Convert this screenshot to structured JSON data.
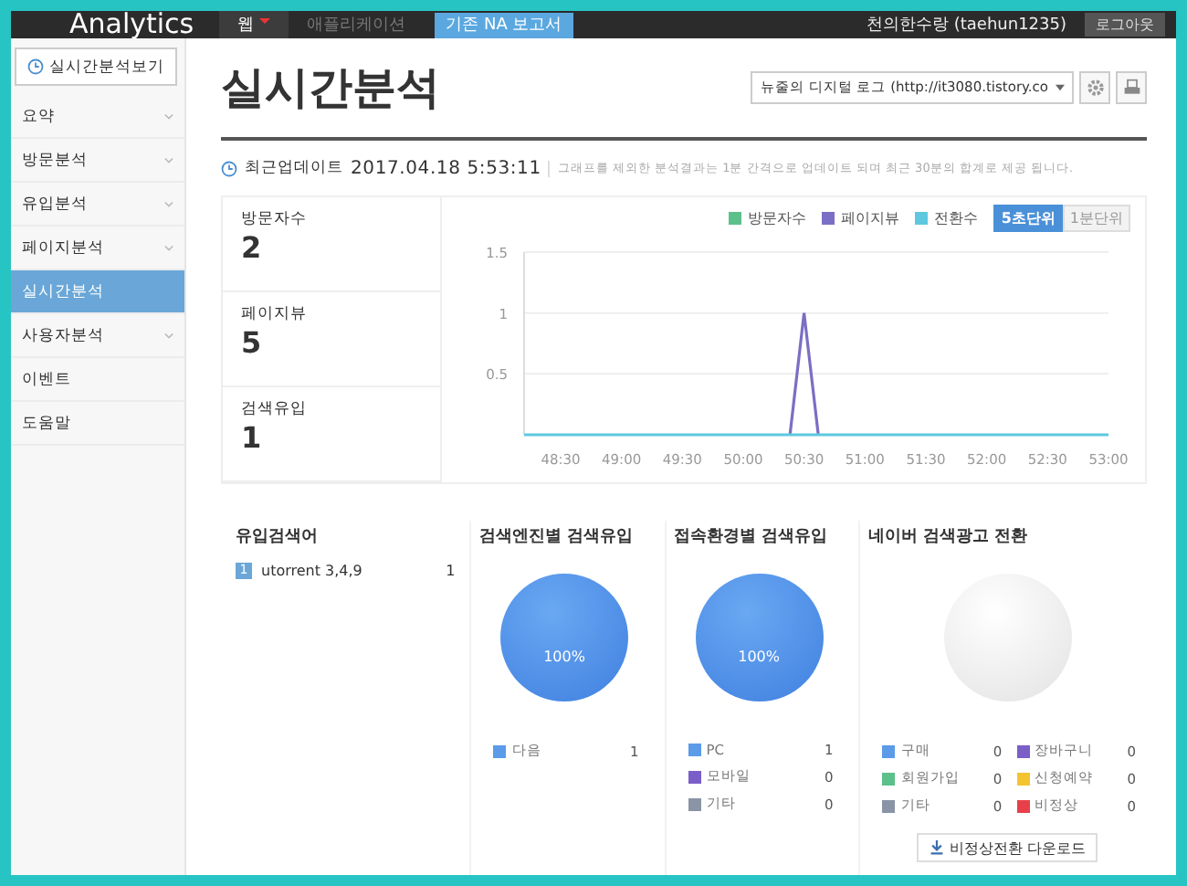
{
  "topbar": {
    "brand": "Analytics",
    "tabs": [
      {
        "label": "웹",
        "selected": true,
        "kind": "menu"
      },
      {
        "label": "애플리케이션",
        "selected": false,
        "kind": "menu"
      },
      {
        "label": "기존 NA 보고서",
        "selected": false,
        "kind": "badge"
      }
    ],
    "user": "천의한수랑 (taehun1235)",
    "logout": "로그아웃"
  },
  "sidebar": {
    "realtime_button": "실시간분석보기",
    "items": [
      {
        "label": "요약",
        "expandable": true,
        "selected": false
      },
      {
        "label": "방문분석",
        "expandable": true,
        "selected": false
      },
      {
        "label": "유입분석",
        "expandable": true,
        "selected": false
      },
      {
        "label": "페이지분석",
        "expandable": true,
        "selected": false
      },
      {
        "label": "실시간분석",
        "expandable": false,
        "selected": true
      },
      {
        "label": "사용자분석",
        "expandable": true,
        "selected": false
      },
      {
        "label": "이벤트",
        "expandable": false,
        "selected": false
      },
      {
        "label": "도움말",
        "expandable": false,
        "selected": false
      }
    ]
  },
  "page": {
    "title": "실시간분석",
    "site_select": "뉴줄의 디지털 로그 (http://it3080.tistory.co",
    "update_label": "최근업데이트",
    "update_time": "2017.04.18 5:53:11",
    "update_note": "그래프를 제외한 분석결과는 1분 간격으로 업데이트 되며 최근 30분의 합계로 제공 됩니다."
  },
  "stats": [
    {
      "label": "방문자수",
      "value": "2"
    },
    {
      "label": "페이지뷰",
      "value": "5"
    },
    {
      "label": "검색유입",
      "value": "1"
    }
  ],
  "units": [
    {
      "label": "5초단위",
      "selected": true
    },
    {
      "label": "1분단위",
      "selected": false
    }
  ],
  "chart_data": {
    "type": "line",
    "x": [
      2892,
      3023,
      3030,
      3037,
      3180
    ],
    "series": [
      {
        "name": "방문자수",
        "color": "#5cc08a",
        "values": [
          null,
          null,
          null,
          null,
          null
        ]
      },
      {
        "name": "페이지뷰",
        "color": "#7a6fc4",
        "values": [
          null,
          0,
          1,
          0,
          null
        ]
      },
      {
        "name": "전환수",
        "color": "#5fc8e0",
        "values": [
          0,
          0,
          0,
          0,
          0
        ]
      }
    ],
    "xlim": [
      2892,
      3180
    ],
    "ylim": [
      0,
      1.5
    ],
    "yticks": [
      0.5,
      1,
      1.5
    ],
    "xticks": [
      {
        "value": 2910,
        "label": "48:30"
      },
      {
        "value": 2940,
        "label": "49:00"
      },
      {
        "value": 2970,
        "label": "49:30"
      },
      {
        "value": 3000,
        "label": "50:00"
      },
      {
        "value": 3030,
        "label": "50:30"
      },
      {
        "value": 3060,
        "label": "51:00"
      },
      {
        "value": 3090,
        "label": "51:30"
      },
      {
        "value": 3120,
        "label": "52:00"
      },
      {
        "value": 3150,
        "label": "52:30"
      },
      {
        "value": 3180,
        "label": "53:00"
      }
    ]
  },
  "search_terms": {
    "title": "유입검색어",
    "rows": [
      {
        "rank": "1",
        "term": "utorrent 3,4,9",
        "count": "1"
      }
    ]
  },
  "pies": [
    {
      "title": "검색엔진별 검색유입",
      "filled": true,
      "label": "100%",
      "legend": [
        {
          "label": "다음",
          "count": "1",
          "color": "#5b9be8"
        }
      ]
    },
    {
      "title": "접속환경별 검색유입",
      "filled": true,
      "label": "100%",
      "legend": [
        {
          "label": "PC",
          "count": "1",
          "color": "#5b9be8"
        },
        {
          "label": "모바일",
          "count": "0",
          "color": "#7a5fc8"
        },
        {
          "label": "기타",
          "count": "0",
          "color": "#8a94a6"
        }
      ]
    },
    {
      "title": "네이버 검색광고 전환",
      "filled": false,
      "legend": [
        {
          "label": "구매",
          "count": "0",
          "color": "#5b9be8"
        },
        {
          "label": "장바구니",
          "count": "0",
          "color": "#7a5fc8"
        },
        {
          "label": "회원가입",
          "count": "0",
          "color": "#5cc08a"
        },
        {
          "label": "신청예약",
          "count": "0",
          "color": "#f4c430"
        },
        {
          "label": "기타",
          "count": "0",
          "color": "#8a94a6"
        },
        {
          "label": "비정상",
          "count": "0",
          "color": "#e8404a"
        }
      ],
      "download": "비정상전환 다운로드"
    }
  ]
}
